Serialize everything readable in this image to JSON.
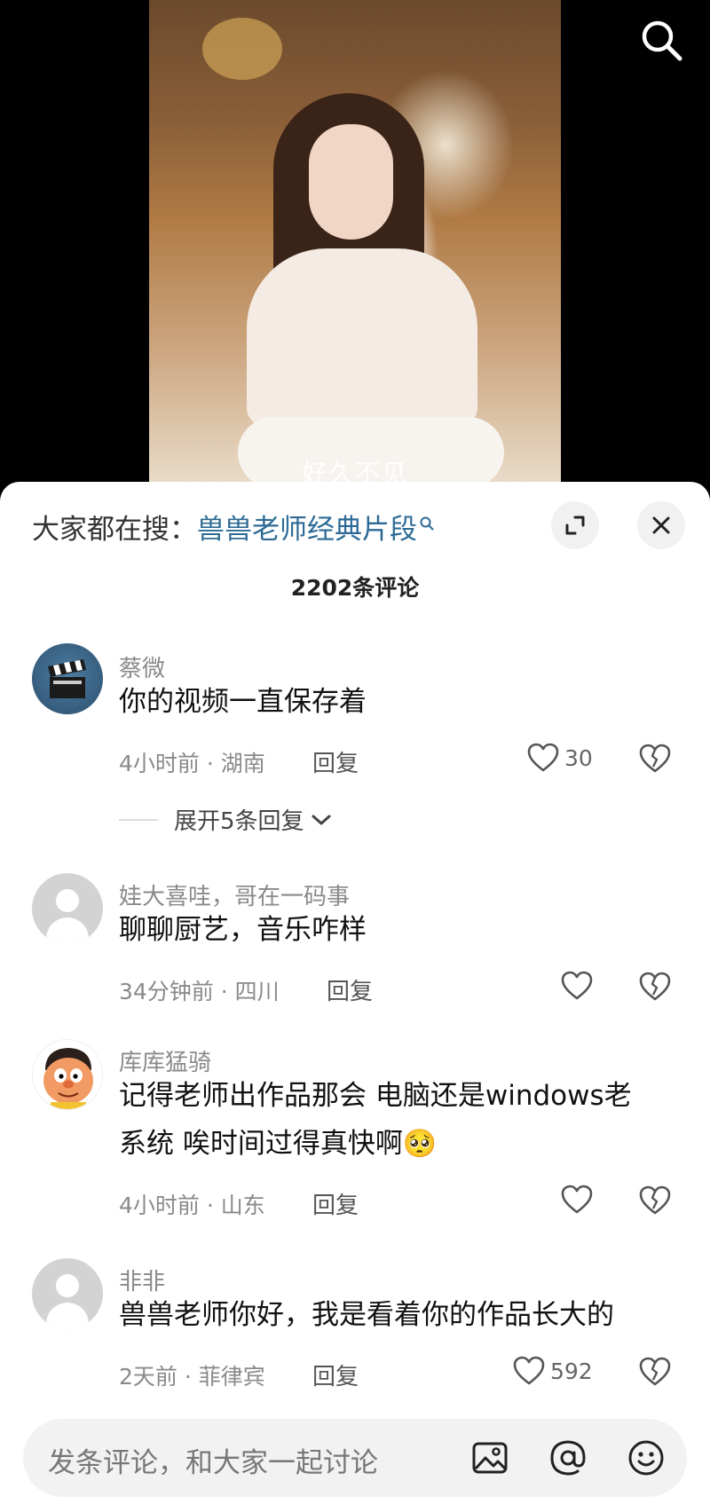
{
  "video": {
    "subtitle": "好久不见"
  },
  "header": {
    "search_prefix": "大家都在搜：",
    "search_term": "兽兽老师经典片段"
  },
  "comment_count": "2202条评论",
  "comments": [
    {
      "user": "蔡微",
      "text_lines": [
        "你的视频一直保存着"
      ],
      "time_location": "4小时前 · 湖南",
      "reply_label": "回复",
      "likes": "30",
      "expand_label": "展开5条回复"
    },
    {
      "user": "娃大喜哇，哥在一码事",
      "text_lines": [
        "聊聊厨艺，音乐咋样"
      ],
      "time_location": "34分钟前 · 四川",
      "reply_label": "回复",
      "likes": ""
    },
    {
      "user": "库库猛骑",
      "text_lines": [
        "记得老师出作品那会 电脑还是windows老",
        "系统 唉时间过得真快啊🥺"
      ],
      "time_location": "4小时前 · 山东",
      "reply_label": "回复",
      "likes": ""
    },
    {
      "user": "非非",
      "text_lines": [
        "兽兽老师你好，我是看着你的作品长大的"
      ],
      "time_location": "2天前 · 菲律宾",
      "reply_label": "回复",
      "likes": "592"
    }
  ],
  "input": {
    "placeholder": "发条评论，和大家一起讨论"
  },
  "icons": {
    "search": "search-icon",
    "expand": "expand-icon",
    "close": "close-icon",
    "like": "heart-icon",
    "dislike": "broken-heart-icon",
    "chevron": "chevron-down-icon",
    "image": "image-icon",
    "mention": "at-icon",
    "emoji": "emoji-icon"
  },
  "colors": {
    "search_term": "#2c6a95",
    "sheet_bg": "#ffffff",
    "meta_text": "#8a8a8a"
  }
}
